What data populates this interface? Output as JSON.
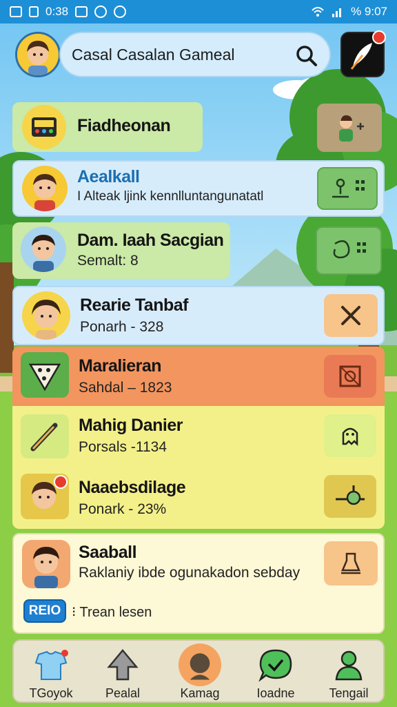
{
  "status_bar": {
    "left_time": "0:38",
    "right_text": "% 9:07"
  },
  "header": {
    "search_text": "Casal Casalan Gameal"
  },
  "rows": [
    {
      "title": "Fiadheonan"
    },
    {
      "title": "Aealkall",
      "subtitle": "I Alteak ljink kennlluntangunatatl"
    },
    {
      "title": "Dam. Iaah Sacgian",
      "subtitle": "Semalt: 8"
    },
    {
      "title": "Rearie Tanbaf",
      "subtitle": "Ponarh - 328"
    },
    {
      "title": "Maralieran",
      "subtitle": "Sahdal – 1823"
    },
    {
      "title": "Mahig Danier",
      "subtitle": "Porsals -1134"
    },
    {
      "title": "Naaebsdilage",
      "subtitle": "Ponark - 23%"
    },
    {
      "title": "Saaball",
      "subtitle": "Raklaniy ibde ogunakadon sebday",
      "badge": "REIO",
      "badge_text": "⁝ Trean lesen"
    }
  ],
  "bottom_nav": [
    {
      "label": "TGoyok"
    },
    {
      "label": "Pealal"
    },
    {
      "label": "Kamag"
    },
    {
      "label": "Ioadne"
    },
    {
      "label": "Tengail"
    }
  ],
  "colors": {
    "status_bar": "#1d8fd6",
    "row_orange": "#f3955f",
    "row_yellow": "#f3f08a",
    "row_cream": "#fdf8d6",
    "row_green": "#cbe9a7",
    "row_blue": "#d7ecfb",
    "title_blue": "#1b6fb0"
  }
}
